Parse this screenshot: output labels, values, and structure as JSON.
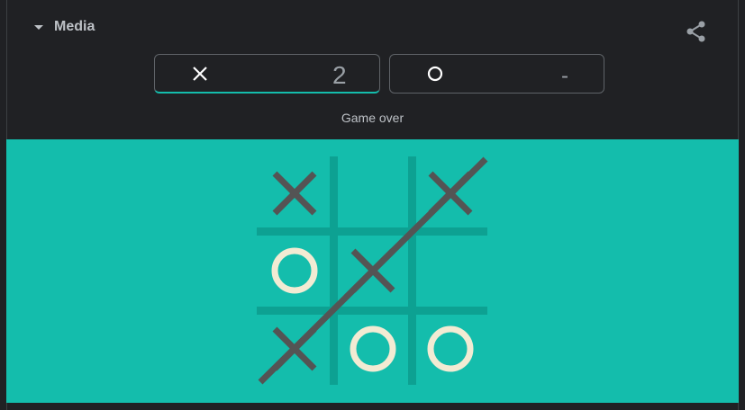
{
  "header": {
    "title": "Media"
  },
  "scores": {
    "x": {
      "value": "2"
    },
    "o": {
      "value": "-"
    }
  },
  "status": "Game over",
  "board": {
    "cells": [
      "X",
      "",
      "X",
      "O",
      "X",
      "",
      "X",
      "O",
      "O"
    ],
    "win_line": "diagonal-bottom-left-to-top-right"
  },
  "colors": {
    "background": "#202124",
    "board": "#14bdac",
    "grid": "#0da192",
    "x_mark": "#545454",
    "o_mark": "#f2ebd3",
    "accent": "#14bdac"
  },
  "icons": {
    "share": "share-icon",
    "collapse": "caret-down-icon",
    "x": "x-mark-icon",
    "o": "o-mark-icon"
  }
}
